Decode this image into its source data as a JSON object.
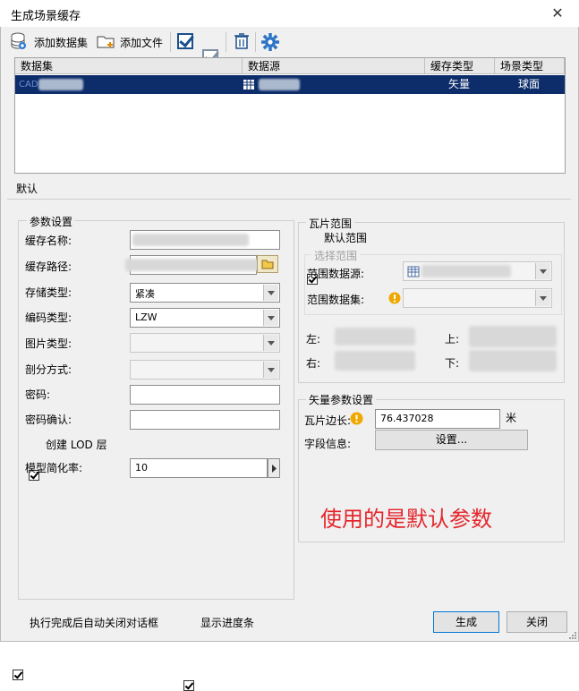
{
  "window": {
    "title": "生成场景缓存",
    "close_glyph": "✕"
  },
  "toolbar": {
    "add_dataset": "添加数据集",
    "add_file": "添加文件"
  },
  "table": {
    "headers": [
      "数据集",
      "数据源",
      "缓存类型",
      "场景类型"
    ],
    "rows": [
      {
        "dataset": "CAD",
        "datasource": "",
        "cache_type": "矢量",
        "scene_type": "球面"
      }
    ]
  },
  "tabs": {
    "default": "默认"
  },
  "params": {
    "group_label": "参数设置",
    "cache_name_label": "缓存名称:",
    "cache_path_label": "缓存路径:",
    "storage_type_label": "存储类型:",
    "storage_type_value": "紧凑",
    "encoding_type_label": "编码类型:",
    "encoding_type_value": "LZW",
    "image_type_label": "图片类型:",
    "split_method_label": "剖分方式:",
    "password_label": "密码:",
    "password_confirm_label": "密码确认:",
    "create_lod_label": "创建 LOD 层",
    "model_simplify_label": "模型简化率:",
    "model_simplify_value": "10"
  },
  "tile_range": {
    "group_label": "瓦片范围",
    "default_range_label": "默认范围",
    "select_range_label": "选择范围",
    "range_datasource_label": "范围数据源:",
    "range_dataset_label": "范围数据集:",
    "left_label": "左:",
    "top_label": "上:",
    "right_label": "右:",
    "bottom_label": "下:"
  },
  "vector": {
    "group_label": "矢量参数设置",
    "tile_side_label": "瓦片边长:",
    "tile_side_value": "76.437028",
    "tile_side_unit": "米",
    "field_info_label": "字段信息:",
    "settings_button": "设置..."
  },
  "annotation": "使用的是默认参数",
  "footer": {
    "auto_close_label": "执行完成后自动关闭对话框",
    "show_progress_label": "显示进度条",
    "generate_button": "生成",
    "close_button": "关闭"
  },
  "colors": {
    "selected_row": "#0d2c6a",
    "annotation": "#e4262c",
    "icon_blue": "#1a4f8c"
  }
}
